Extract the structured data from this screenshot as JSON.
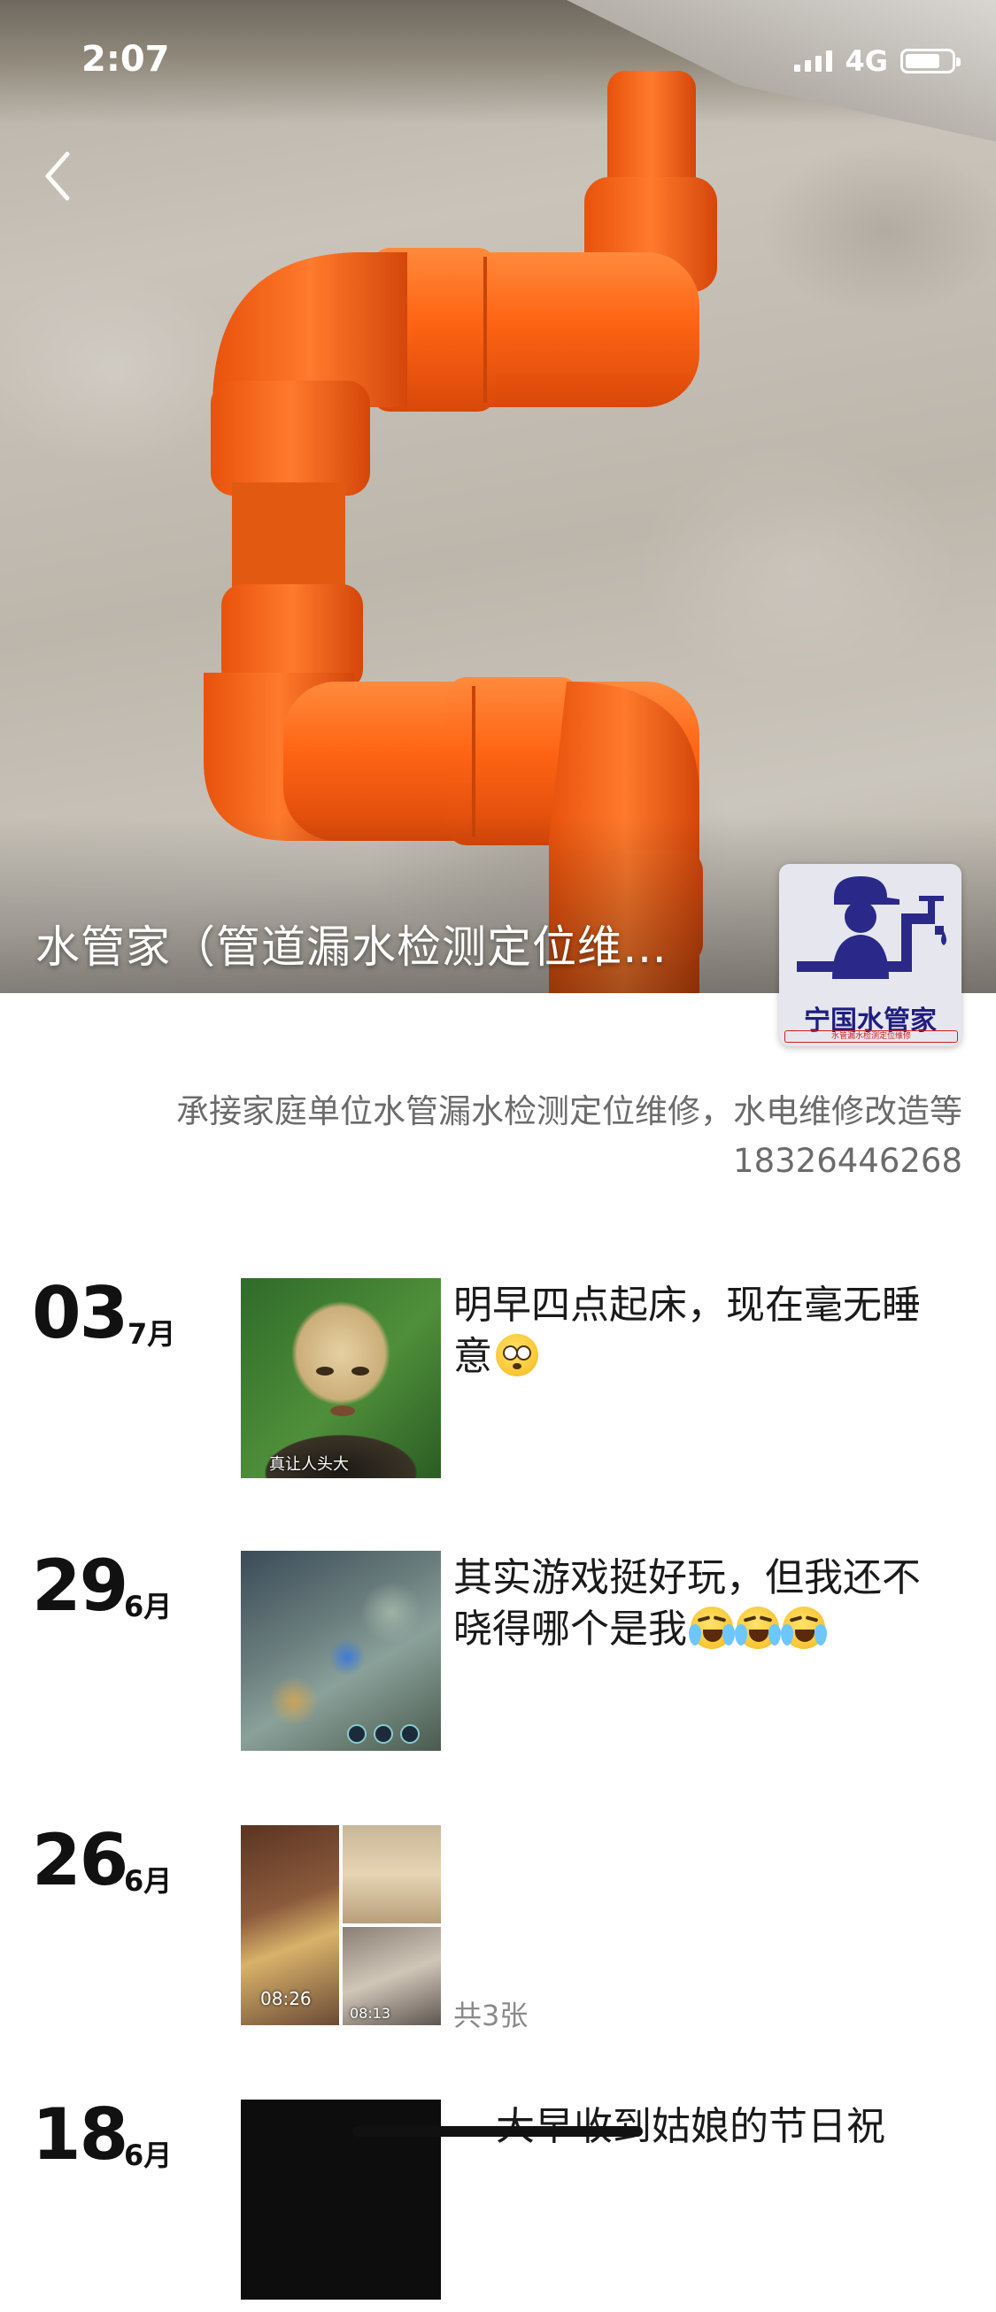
{
  "status_bar": {
    "time": "2:07",
    "network": "4G",
    "battery_level": 0.75
  },
  "cover": {
    "title": "水管家（管道漏水检测定位维…",
    "back_icon": "chevron-left-icon",
    "pipe_color": "#ff6a1f",
    "wall_color": "#c2bcb2"
  },
  "profile": {
    "avatar": {
      "brand": "宁国水管家",
      "tagline": "水管漏水检测定位维修",
      "accent": "#1f1d80"
    },
    "bio_line1": "承接家庭单位水管漏水检测定位维修，水电维修改造等",
    "bio_line2": "18326446268"
  },
  "posts": [
    {
      "day": "03",
      "month": "7月",
      "text": "明早四点起床，现在毫无睡意",
      "emojis": [
        "flushed-emoji"
      ],
      "thumb_caption": "真让人头大"
    },
    {
      "day": "29",
      "month": "6月",
      "text": "其实游戏挺好玩，但我还不晓得哪个是我",
      "emojis": [
        "crying-laughing-emoji",
        "crying-laughing-emoji",
        "crying-laughing-emoji"
      ]
    },
    {
      "day": "26",
      "month": "6月",
      "text": "",
      "count": "共3张",
      "thumb_stamps": [
        "08:26",
        "08:13"
      ]
    },
    {
      "day": "18",
      "month": "6月",
      "text": "大早收到姑娘的节日祝"
    }
  ]
}
